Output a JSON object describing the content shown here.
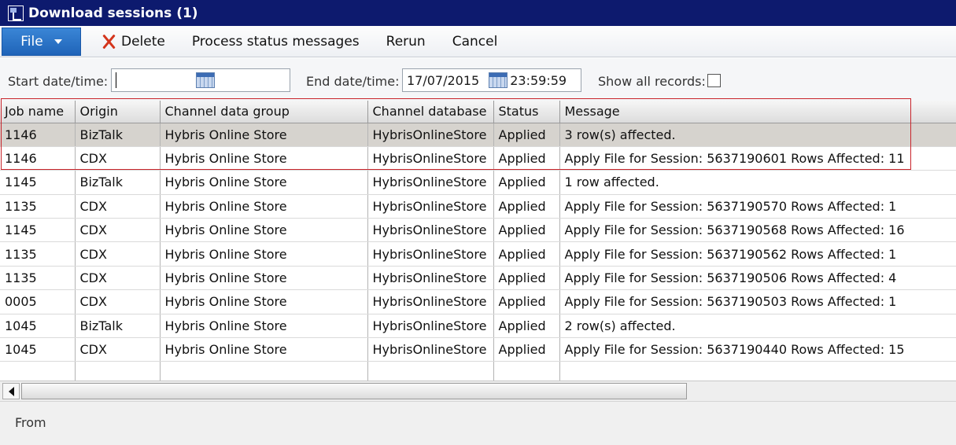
{
  "window": {
    "title": "Download sessions (1)"
  },
  "ribbon": {
    "file_label": "File",
    "delete_label": "Delete",
    "process_label": "Process status messages",
    "rerun_label": "Rerun",
    "cancel_label": "Cancel"
  },
  "filters": {
    "start_label": "Start date/time:",
    "start_value": "",
    "end_label": "End date/time:",
    "end_date": "17/07/2015",
    "end_time": "23:59:59",
    "show_all_label": "Show all records:",
    "show_all_checked": false
  },
  "grid": {
    "columns": [
      "Job name",
      "Origin",
      "Channel data group",
      "Channel database",
      "Status",
      "Message"
    ],
    "rows": [
      [
        "1146",
        "BizTalk",
        "Hybris Online Store",
        "HybrisOnlineStore",
        "Applied",
        "3 row(s) affected."
      ],
      [
        "1146",
        "CDX",
        "Hybris Online Store",
        "HybrisOnlineStore",
        "Applied",
        "Apply File for Session: 5637190601  Rows Affected: 11"
      ],
      [
        "1145",
        "BizTalk",
        "Hybris Online Store",
        "HybrisOnlineStore",
        "Applied",
        "1 row affected."
      ],
      [
        "1135",
        "CDX",
        "Hybris Online Store",
        "HybrisOnlineStore",
        "Applied",
        "Apply File for Session: 5637190570  Rows Affected: 1"
      ],
      [
        "1145",
        "CDX",
        "Hybris Online Store",
        "HybrisOnlineStore",
        "Applied",
        "Apply File for Session: 5637190568  Rows Affected: 16"
      ],
      [
        "1135",
        "CDX",
        "Hybris Online Store",
        "HybrisOnlineStore",
        "Applied",
        "Apply File for Session: 5637190562  Rows Affected: 1"
      ],
      [
        "1135",
        "CDX",
        "Hybris Online Store",
        "HybrisOnlineStore",
        "Applied",
        "Apply File for Session: 5637190506  Rows Affected: 4"
      ],
      [
        "0005",
        "CDX",
        "Hybris Online Store",
        "HybrisOnlineStore",
        "Applied",
        "Apply File for Session: 5637190503  Rows Affected: 1"
      ],
      [
        "1045",
        "BizTalk",
        "Hybris Online Store",
        "HybrisOnlineStore",
        "Applied",
        "2 row(s) affected."
      ],
      [
        "1045",
        "CDX",
        "Hybris Online Store",
        "HybrisOnlineStore",
        "Applied",
        "Apply File for Session: 5637190440  Rows Affected: 15"
      ]
    ],
    "selected_row": 0
  },
  "status": {
    "from_label": "From"
  },
  "colors": {
    "titlebar": "#0d1a6e",
    "file_button": "#2a73c7",
    "highlight_box": "#c8242b",
    "delete_icon": "#d4351c"
  },
  "icons": {
    "delete": "x-delete-icon",
    "calendar": "calendar-icon"
  }
}
